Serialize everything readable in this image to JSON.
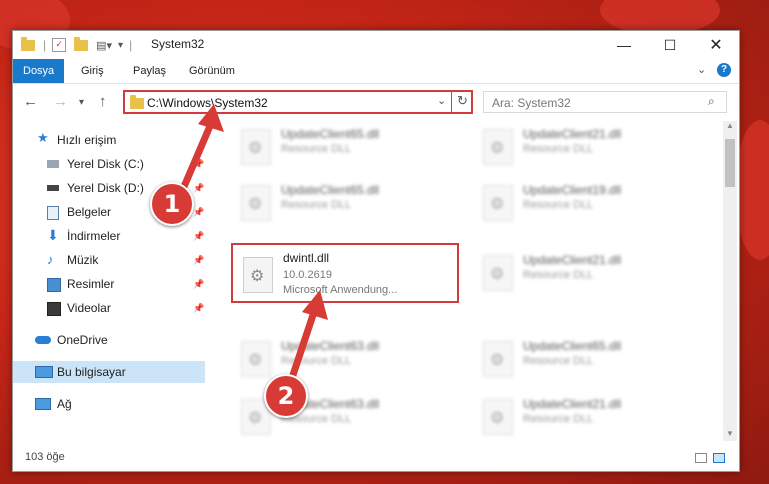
{
  "window": {
    "title": "System32"
  },
  "ribbon": {
    "tabs": [
      "Dosya",
      "Giriş",
      "Paylaş",
      "Görünüm"
    ]
  },
  "address": {
    "path": "C:\\Windows\\System32"
  },
  "search": {
    "placeholder": "Ara: System32"
  },
  "sidebar": {
    "items": [
      {
        "label": "Hızlı erişim",
        "icon": "star-icon"
      },
      {
        "label": "Yerel Disk (C:)",
        "icon": "drive-icon"
      },
      {
        "label": "Yerel Disk (D:)",
        "icon": "drive-icon"
      },
      {
        "label": "Belgeler",
        "icon": "document-icon"
      },
      {
        "label": "İndirmeler",
        "icon": "download-icon"
      },
      {
        "label": "Müzik",
        "icon": "music-icon"
      },
      {
        "label": "Resimler",
        "icon": "picture-icon"
      },
      {
        "label": "Videolar",
        "icon": "video-icon"
      },
      {
        "label": "OneDrive",
        "icon": "cloud-icon"
      },
      {
        "label": "Bu bilgisayar",
        "icon": "computer-icon"
      },
      {
        "label": "Ağ",
        "icon": "network-icon"
      }
    ]
  },
  "files": {
    "left": [
      {
        "name": "UpdateClient65.dll",
        "type": "Resource DLL"
      },
      {
        "name": "UpdateClient65.dll",
        "type": "Resource DLL"
      },
      {
        "name": "UpdateClient63.dll",
        "type": "Resource DLL"
      },
      {
        "name": "UpdateClient63.dll",
        "type": "Resource DLL"
      }
    ],
    "right": [
      {
        "name": "UpdateClient21.dll",
        "type": "Resource DLL"
      },
      {
        "name": "UpdateClient19.dll",
        "type": "Resource DLL"
      },
      {
        "name": "UpdateClient21.dll",
        "type": "Resource DLL"
      },
      {
        "name": "UpdateClient65.dll",
        "type": "Resource DLL"
      },
      {
        "name": "UpdateClient21.dll",
        "type": "Resource DLL"
      }
    ],
    "highlighted": {
      "name": "dwintl.dll",
      "version": "10.0.2619",
      "company": "Microsoft Anwendung..."
    }
  },
  "status": {
    "count": "103 öğe"
  },
  "callouts": [
    "1",
    "2"
  ],
  "colors": {
    "accent": "#1979ca",
    "highlight": "#d23b3b",
    "callout": "#d83b35"
  }
}
